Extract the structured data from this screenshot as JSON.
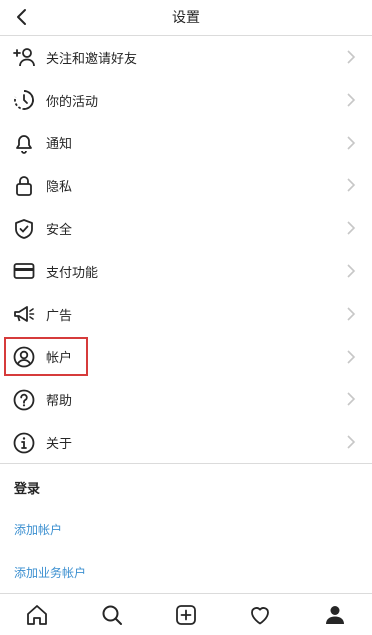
{
  "header": {
    "title": "设置",
    "back_icon": "chevron-left-icon"
  },
  "menu": {
    "items": [
      {
        "label": "关注和邀请好友",
        "icon": "add-person-icon"
      },
      {
        "label": "你的活动",
        "icon": "activity-clock-icon"
      },
      {
        "label": "通知",
        "icon": "bell-icon"
      },
      {
        "label": "隐私",
        "icon": "lock-icon"
      },
      {
        "label": "安全",
        "icon": "shield-check-icon"
      },
      {
        "label": "支付功能",
        "icon": "credit-card-icon"
      },
      {
        "label": "广告",
        "icon": "megaphone-icon"
      },
      {
        "label": "帐户",
        "icon": "user-circle-icon"
      },
      {
        "label": "帮助",
        "icon": "question-circle-icon"
      },
      {
        "label": "关于",
        "icon": "info-circle-icon"
      }
    ]
  },
  "login": {
    "title": "登录",
    "add_account": "添加帐户",
    "add_business_account": "添加业务帐户"
  },
  "tabbar": {
    "items": [
      "home-icon",
      "search-icon",
      "new-post-icon",
      "heart-icon",
      "profile-icon"
    ]
  },
  "colors": {
    "link": "#3b8fd0",
    "highlight": "#d63b3b",
    "divider": "#dbdbdb",
    "text": "#262626"
  }
}
